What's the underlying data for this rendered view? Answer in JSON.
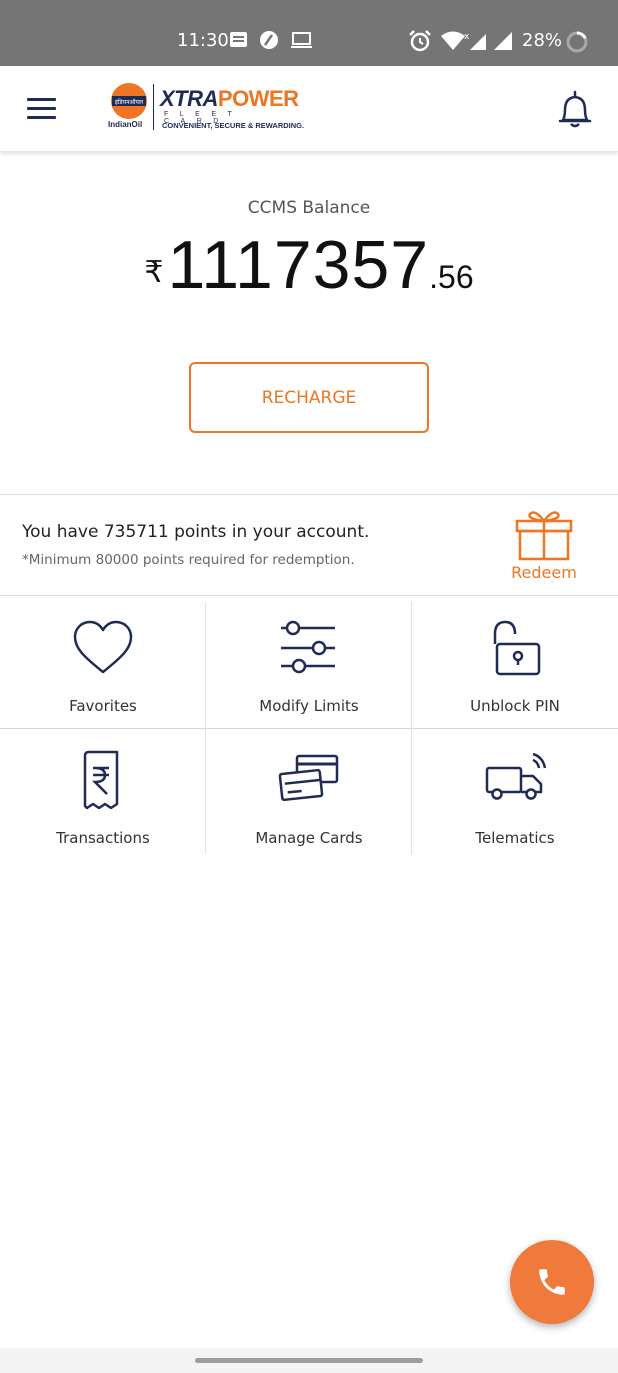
{
  "status_bar": {
    "time": "11:30",
    "battery": "28%"
  },
  "header": {
    "logo": {
      "brand_left": "इंडियनऑयल",
      "brand_left_caption": "IndianOil",
      "title_part1": "XTRA",
      "title_part2": "POWER",
      "subtitle": "FLEET CARD",
      "tagline": "CONVENIENT, SECURE & REWARDING."
    },
    "menu_icon": "hamburger-icon",
    "notification_icon": "bell-icon"
  },
  "balance": {
    "label": "CCMS Balance",
    "currency": "₹",
    "integer": "1117357",
    "decimal": ".56"
  },
  "recharge_label": "RECHARGE",
  "points": {
    "text": "You have 735711 points in your account.",
    "note": "*Minimum 80000 points required for redemption.",
    "redeem_label": "Redeem"
  },
  "tiles": [
    {
      "label": "Favorites",
      "icon": "heart-icon"
    },
    {
      "label": "Modify Limits",
      "icon": "sliders-icon"
    },
    {
      "label": "Unblock PIN",
      "icon": "unlock-icon"
    },
    {
      "label": "Transactions",
      "icon": "rupee-receipt-icon"
    },
    {
      "label": "Manage Cards",
      "icon": "cards-icon"
    },
    {
      "label": "Telematics",
      "icon": "truck-signal-icon"
    }
  ],
  "colors": {
    "accent": "#ee7623",
    "navy": "#1f2a55",
    "status_bar": "#757575"
  },
  "fab_icon": "phone-icon"
}
